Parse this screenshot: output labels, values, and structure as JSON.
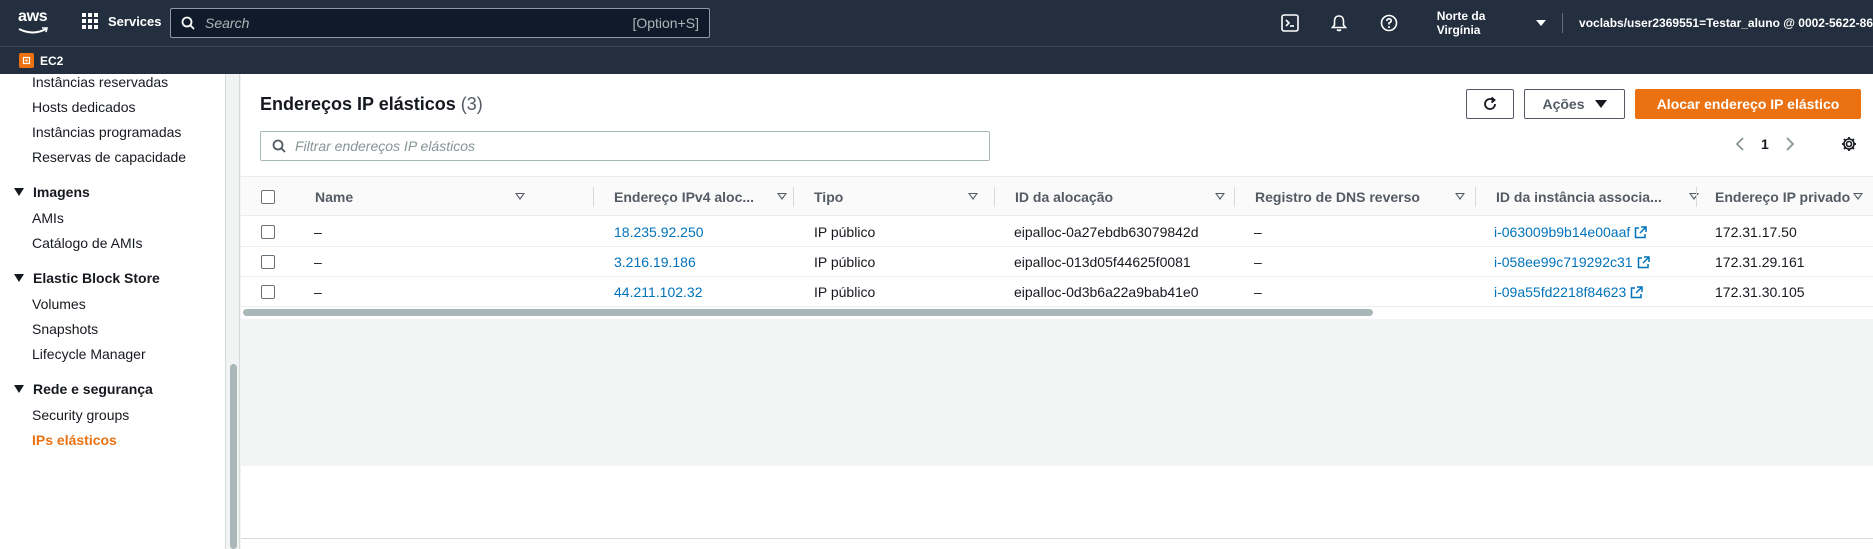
{
  "topnav": {
    "logo_text": "aws",
    "services_label": "Services",
    "search_placeholder": "Search",
    "search_shortcut": "[Option+S]",
    "region": "Norte da Virgínia",
    "account": "voclabs/user2369551=Testar_aluno @ 0002-5622-86"
  },
  "subnav": {
    "service": "EC2"
  },
  "sidebar": {
    "items": [
      {
        "label": "Instâncias reservadas",
        "type": "item"
      },
      {
        "label": "Hosts dedicados",
        "type": "item"
      },
      {
        "label": "Instâncias programadas",
        "type": "item"
      },
      {
        "label": "Reservas de capacidade",
        "type": "item"
      },
      {
        "label": "Imagens",
        "type": "section"
      },
      {
        "label": "AMIs",
        "type": "item"
      },
      {
        "label": "Catálogo de AMIs",
        "type": "item"
      },
      {
        "label": "Elastic Block Store",
        "type": "section"
      },
      {
        "label": "Volumes",
        "type": "item"
      },
      {
        "label": "Snapshots",
        "type": "item"
      },
      {
        "label": "Lifecycle Manager",
        "type": "item"
      },
      {
        "label": "Rede e segurança",
        "type": "section"
      },
      {
        "label": "Security groups",
        "type": "item"
      },
      {
        "label": "IPs elásticos",
        "type": "item",
        "active": true
      }
    ]
  },
  "main": {
    "title": "Endereços IP elásticos",
    "count": "(3)",
    "actions_label": "Ações",
    "primary_label": "Alocar endereço IP elástico",
    "filter_placeholder": "Filtrar endereços IP elásticos",
    "page": "1",
    "columns": [
      "Name",
      "Endereço IPv4 aloc...",
      "Tipo",
      "ID da alocação",
      "Registro de DNS reverso",
      "ID da instância associa...",
      "Endereço IP privado"
    ],
    "rows": [
      {
        "name": "–",
        "ipv4": "18.235.92.250",
        "tipo": "IP público",
        "alloc": "eipalloc-0a27ebdb63079842d",
        "dns": "–",
        "instance": "i-063009b9b14e00aaf",
        "private_ip": "172.31.17.50"
      },
      {
        "name": "–",
        "ipv4": "3.216.19.186",
        "tipo": "IP público",
        "alloc": "eipalloc-013d05f44625f0081",
        "dns": "–",
        "instance": "i-058ee99c719292c31",
        "private_ip": "172.31.29.161"
      },
      {
        "name": "–",
        "ipv4": "44.211.102.32",
        "tipo": "IP público",
        "alloc": "eipalloc-0d3b6a22a9bab41e0",
        "dns": "–",
        "instance": "i-09a55fd2218f84623",
        "private_ip": "172.31.30.105"
      }
    ]
  },
  "colors": {
    "accent": "#ec7211",
    "nav_bg": "#232f3e",
    "link": "#0073bb"
  }
}
